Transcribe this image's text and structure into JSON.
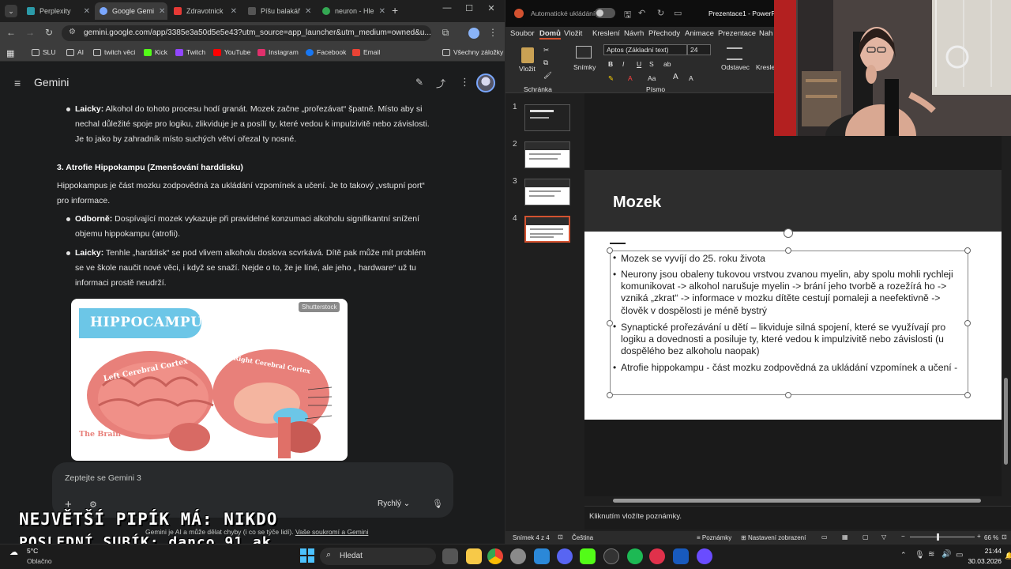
{
  "browser": {
    "tabs": [
      {
        "label": "Perplexity",
        "color": "#2b9aa8"
      },
      {
        "label": "Google Gemi",
        "color": "#7aa7ff"
      },
      {
        "label": "Zdravotnick",
        "color": "#e53935"
      },
      {
        "label": "Píšu balakář",
        "color": "#444444"
      },
      {
        "label": "neuron - Hle",
        "color": "#34a853"
      }
    ],
    "url": "gemini.google.com/app/3385e3a50d5e5e43?utm_source=app_launcher&utm_medium=owned&u...",
    "bookmarks": [
      "SLU",
      "AI",
      "twitch věci",
      "Kick",
      "Twitch",
      "YouTube",
      "Instagram",
      "Facebook",
      "Email"
    ],
    "all_bookmarks": "Všechny záložky"
  },
  "gemini": {
    "title": "Gemini",
    "p1_head": "Laicky:",
    "p1_lines": [
      "Alkohol do tohoto procesu hodí granát. Mozek začne „prořezávat“ špatně. Místo aby si",
      "nechal důležité spoje pro logiku, zlikviduje je a posílí ty, které vedou k impulzivitě nebo závislosti.",
      "Je to jako by zahradník místo suchých větví ořezal ty nosné."
    ],
    "section_heading": "3. Atrofie Hippokampu (Zmenšování harddisku)",
    "intro_lines": [
      "Hippokampus je část mozku zodpovědná za ukládání vzpomínek a učení. Je to takový „vstupní port“",
      "pro informace."
    ],
    "p2_head": "Odborně:",
    "p2_lines": [
      "Dospívající mozek vykazuje při pravidelné konzumaci alkoholu signifikantní snížení",
      "objemu hippokampu (atrofii)."
    ],
    "p3_head": "Laicky:",
    "p3_lines": [
      "Tenhle „harddisk“ se pod vlivem alkoholu doslova scvrkává. Dítě pak může mít problém",
      "se ve škole naučit nové věci, i když se snaží. Nejde o to, že je líné, ale jeho „ hardware“ už tu",
      "informaci prostě neudrží."
    ],
    "image": {
      "title": "HIPPOCAMPUS",
      "badge": "Shutterstock",
      "label_left": "Left Cerebral Cortex",
      "label_right": "Right Cerebral Cortex",
      "label_bottom": "The Brain"
    },
    "prompt_placeholder": "Zeptejte se Gemini 3",
    "mode": "Rychlý",
    "disclaimer": "Gemini je AI a může dělat chyby (i co se týče lidí).",
    "disclaimer_link": "Vaše soukromí a Gemini"
  },
  "overlay": {
    "line1": "NEJVĚTŠÍ PIPÍK MÁ: NIKDO",
    "line2": "POSLEDNÍ SUBÍK: danco_91_ak"
  },
  "ppt": {
    "autosave": "Automatické ukládání",
    "doc_title": "Prezentace1 - PowerP",
    "tabs": [
      "Soubor",
      "Domů",
      "Vložit",
      "Kreslení",
      "Návrh",
      "Přechody",
      "Animace",
      "Prezentace",
      "Nah"
    ],
    "paste": "Vložit",
    "clipboard": "Schránka",
    "slides_btn": "Snímky",
    "font_name": "Aptos (Základní text)",
    "font_size": "24",
    "font_group": "Písmo",
    "paragraph": "Odstavec",
    "draw": "Kresle",
    "thumb_numbers": [
      "1",
      "2",
      "3",
      "4"
    ],
    "slide_title": "Mozek",
    "bullets": [
      "Mozek se vyvíjí do 25. roku života",
      "Neurony jsou obaleny tukovou vrstvou zvanou myelin, aby spolu mohli rychleji komunikovat -> alkohol narušuje myelin -> brání jeho tvorbě a rozežírá ho -> vzniká „zkrat“ -> informace v mozku dítěte cestují pomaleji a neefektivně -> člověk v dospělosti je méně bystrý",
      "Synaptické prořezávání u dětí – likviduje silná spojení, které se využívají pro logiku a dovednosti a posiluje ty, které vedou k impulzivitě nebo závislosti (u dospělého bez alkoholu naopak)",
      "Atrofie hippokampu - část mozku zodpovědná za ukládání vzpomínek a učení -"
    ],
    "notes_placeholder": "Kliknutím vložíte poznámky.",
    "status_slide": "Snímek 4 z 4",
    "status_lang": "Čeština",
    "status_notes": "Poznámky",
    "status_view": "Nastavení zobrazení",
    "zoom": "66 %"
  },
  "taskbar": {
    "weather_temp": "5°C",
    "weather_desc": "Oblačno",
    "search_placeholder": "Hledat",
    "time": "21:44",
    "date": "30.03.2026"
  }
}
